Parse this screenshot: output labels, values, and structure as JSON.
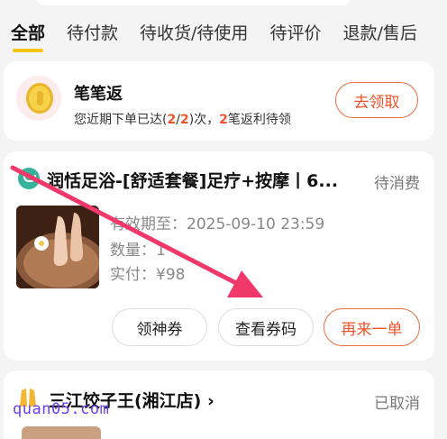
{
  "tabs": [
    "全部",
    "待付款",
    "待收货/待使用",
    "待评价",
    "退款/售后"
  ],
  "promo": {
    "title": "笔笔返",
    "desc_prefix": "您近期下单已达(",
    "count": "2",
    "slash": "/",
    "total": "2",
    "desc_mid": ")次，",
    "rebate": "2",
    "desc_suffix": "笔返利待领",
    "claim_label": "去领取"
  },
  "order1": {
    "shop_name": "润恬足浴-[舒适套餐]足疗+按摩丨6...",
    "status": "待消费",
    "validity": "有效期至：2025-09-10 23:59",
    "quantity": "数量：1",
    "paid": "实付：¥98",
    "btn_coupon": "领神券",
    "btn_view": "查看券码",
    "btn_reorder": "再来一单"
  },
  "order2": {
    "shop_name": "三江饺子王(湘江店)",
    "chevron": "›",
    "status": "已取消"
  },
  "watermark": "quan05.com",
  "colors": {
    "accent": "#e8542b",
    "tab_indicator": "#f5c518",
    "arrow": "#f0386b",
    "watermark": "#6a3ff0"
  },
  "icons": [
    "coin-icon",
    "shop-logo-icon",
    "chevron-right-icon"
  ]
}
